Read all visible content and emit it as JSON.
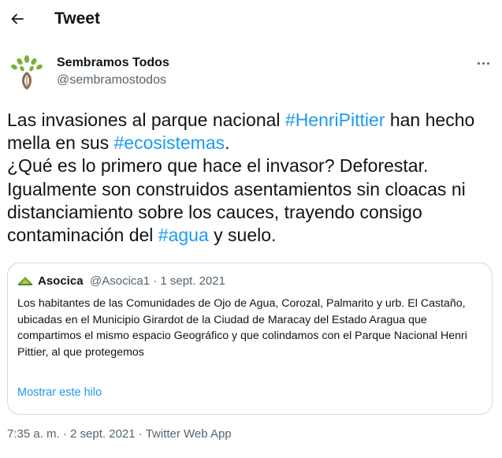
{
  "header": {
    "title": "Tweet",
    "back_icon": "arrow-left-icon"
  },
  "author": {
    "name": "Sembramos Todos",
    "handle": "@sembramostodos",
    "avatar_icon": "plant-logo-icon"
  },
  "more_icon": "more-dots-icon",
  "tweet": {
    "seg1": "Las invasiones al parque nacional ",
    "tag1": "#HenriPittier",
    "seg2": " han hecho mella en sus ",
    "tag2": "#ecosistemas",
    "seg3": ".",
    "seg4": "¿Qué es lo primero que hace el invasor? Deforestar. Igualmente son construidos asentamientos sin cloacas ni distanciamiento sobre los cauces, trayendo consigo contaminación del ",
    "tag3": "#agua",
    "seg5": " y suelo."
  },
  "quote": {
    "name": "Asocica",
    "meta": "@Asocica1 · 1 sept. 2021",
    "line1": "Los habitantes de las Comunidades de Ojo de Agua, Corozal, Palmarito y urb. El Castaño, ubicadas en el Municipio Girardot de la Ciudad de Maracay del Estado Aragua que",
    "line2": "compartimos el mismo espacio Geográfico y que colindamos con el Parque Nacional Henri Pittier, al que protegemos",
    "show_thread": "Mostrar este hilo",
    "avatar_icon": "asocica-logo-icon"
  },
  "footer": {
    "time": "7:35 a. m.",
    "sep1": " · ",
    "date": "2 sept. 2021",
    "sep2": " · ",
    "source": "Twitter Web App"
  },
  "colors": {
    "link": "#1d9bf0",
    "secondary": "#536471",
    "text": "#0f1419",
    "border": "#cfd9de"
  }
}
